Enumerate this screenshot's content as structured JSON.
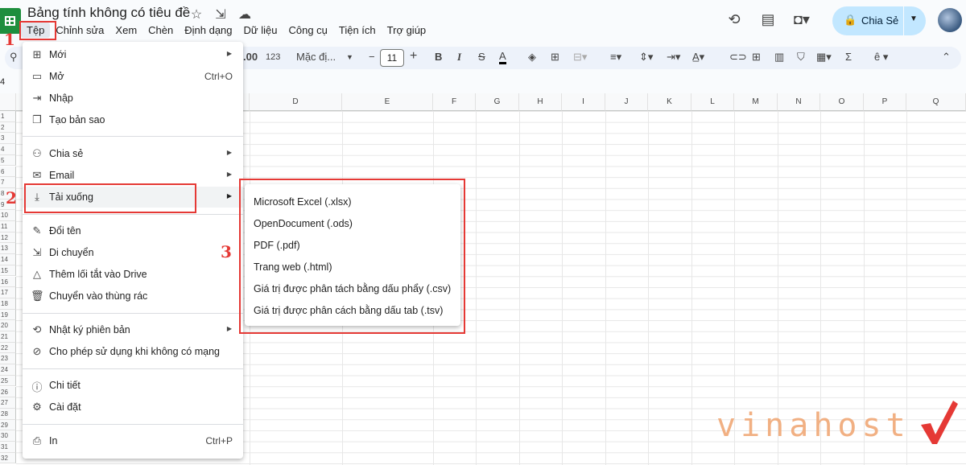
{
  "doc": {
    "title": "Bảng tính không có tiêu đề"
  },
  "menubar": [
    "Tệp",
    "Chỉnh sửa",
    "Xem",
    "Chèn",
    "Định dạng",
    "Dữ liệu",
    "Công cụ",
    "Tiện ích",
    "Trợ giúp"
  ],
  "share": {
    "label": "Chia Sẻ"
  },
  "toolbar": {
    "decimal": ".00",
    "number_format": "123",
    "font": "Mặc đị...",
    "font_size": "11"
  },
  "cell_ref": "4",
  "columns": [
    "D",
    "E",
    "F",
    "G",
    "H",
    "I",
    "J",
    "K",
    "L",
    "M",
    "N",
    "O",
    "P",
    "Q"
  ],
  "rows": [
    "1",
    "2",
    "3",
    "4",
    "5",
    "6",
    "7",
    "8",
    "9",
    "10",
    "11",
    "12",
    "13",
    "14",
    "15",
    "16",
    "17",
    "18",
    "19",
    "20",
    "21",
    "22",
    "23",
    "24",
    "25",
    "26",
    "27",
    "28",
    "29",
    "30",
    "31",
    "32"
  ],
  "file_menu": {
    "items": [
      {
        "label": "Mới",
        "icon": "plus-box-icon",
        "submenu": true
      },
      {
        "label": "Mở",
        "icon": "folder-icon",
        "shortcut": "Ctrl+O"
      },
      {
        "label": "Nhập",
        "icon": "import-icon"
      },
      {
        "label": "Tạo bản sao",
        "icon": "copy-icon"
      },
      {
        "label": "Chia sẻ",
        "icon": "person-add-icon",
        "submenu": true
      },
      {
        "label": "Email",
        "icon": "mail-icon",
        "submenu": true
      },
      {
        "label": "Tải xuống",
        "icon": "download-icon",
        "submenu": true
      },
      {
        "label": "Đổi tên",
        "icon": "rename-icon"
      },
      {
        "label": "Di chuyển",
        "icon": "move-folder-icon"
      },
      {
        "label": "Thêm lối tắt vào Drive",
        "icon": "drive-shortcut-icon"
      },
      {
        "label": "Chuyển vào thùng rác",
        "icon": "trash-icon"
      },
      {
        "label": "Nhật ký phiên bản",
        "icon": "history-icon",
        "submenu": true
      },
      {
        "label": "Cho phép sử dụng khi không có mạng",
        "icon": "offline-icon"
      },
      {
        "label": "Chi tiết",
        "icon": "info-icon"
      },
      {
        "label": "Cài đặt",
        "icon": "gear-icon"
      },
      {
        "label": "In",
        "icon": "print-icon",
        "shortcut": "Ctrl+P"
      }
    ]
  },
  "download_submenu": {
    "items": [
      "Microsoft Excel (.xlsx)",
      "OpenDocument (.ods)",
      "PDF (.pdf)",
      "Trang web (.html)",
      "Giá trị được phân tách bằng dấu phẩy (.csv)",
      "Giá trị được phân cách bằng dấu tab (.tsv)"
    ]
  },
  "annotations": {
    "step1": "1",
    "step2": "2",
    "step3": "3",
    "color": "#e53935"
  },
  "watermark": "vinahost"
}
